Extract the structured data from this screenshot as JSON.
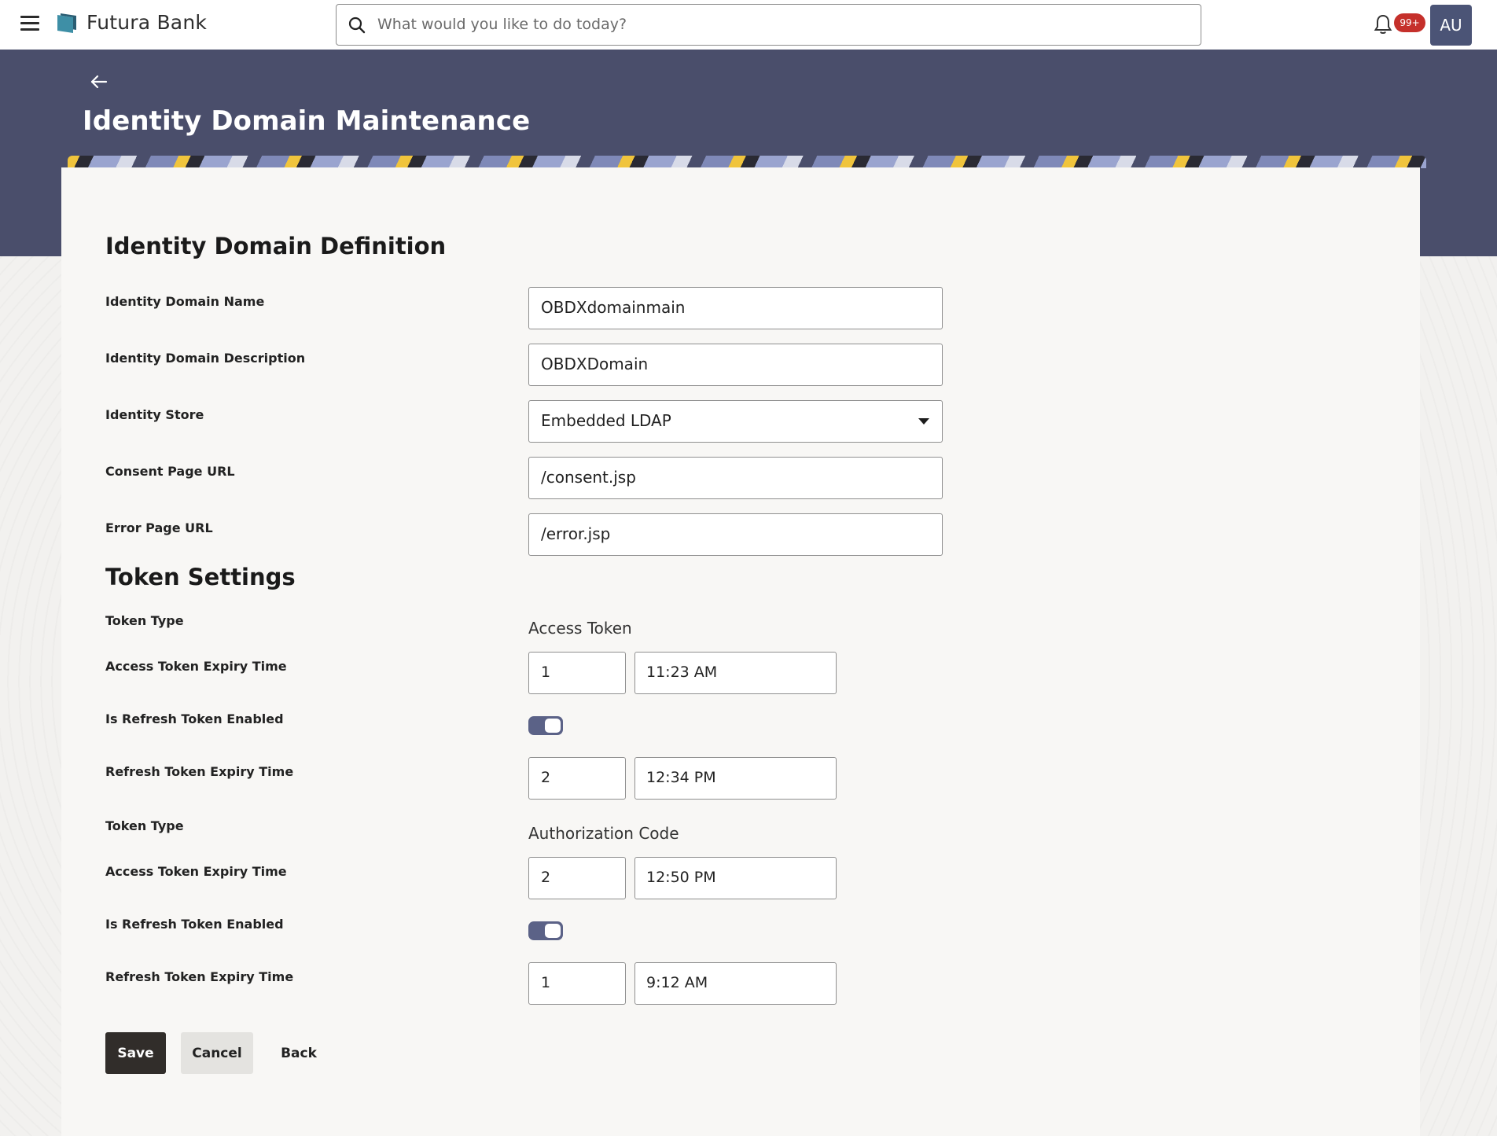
{
  "app": {
    "brand": "Futura Bank"
  },
  "search": {
    "placeholder": "What would you like to do today?"
  },
  "notifications": {
    "badge": "99+"
  },
  "user": {
    "initials": "AU"
  },
  "page": {
    "title": "Identity Domain Maintenance"
  },
  "definition": {
    "title": "Identity Domain Definition",
    "fields": [
      {
        "label": "Identity Domain Name",
        "value": "OBDXdomainmain"
      },
      {
        "label": "Identity Domain Description",
        "value": "OBDXDomain"
      },
      {
        "label": "Identity Store",
        "value": "Embedded LDAP"
      },
      {
        "label": "Consent Page URL",
        "value": "/consent.jsp"
      },
      {
        "label": "Error Page URL",
        "value": "/error.jsp"
      }
    ]
  },
  "tokens": {
    "title": "Token Settings",
    "groups": [
      {
        "type_label": "Token Type",
        "type_value": "Access Token",
        "access_label": "Access Token Expiry Time",
        "access_count": "1",
        "access_time": "11:23 AM",
        "refresh_enabled_label": "Is Refresh Token Enabled",
        "refresh_enabled": true,
        "refresh_label": "Refresh Token Expiry Time",
        "refresh_count": "2",
        "refresh_time": "12:34 PM"
      },
      {
        "type_label": "Token Type",
        "type_value": "Authorization Code",
        "access_label": "Access Token Expiry Time",
        "access_count": "2",
        "access_time": "12:50 PM",
        "refresh_enabled_label": "Is Refresh Token Enabled",
        "refresh_enabled": true,
        "refresh_label": "Refresh Token Expiry Time",
        "refresh_count": "1",
        "refresh_time": "9:12 AM"
      }
    ]
  },
  "actions": {
    "save": "Save",
    "cancel": "Cancel",
    "back": "Back"
  },
  "colors": {
    "header_band": "#4a4e6b",
    "primary_button": "#312d2a",
    "toggle_on": "#5b6287",
    "badge": "#c5302b",
    "avatar": "#4b5476"
  }
}
